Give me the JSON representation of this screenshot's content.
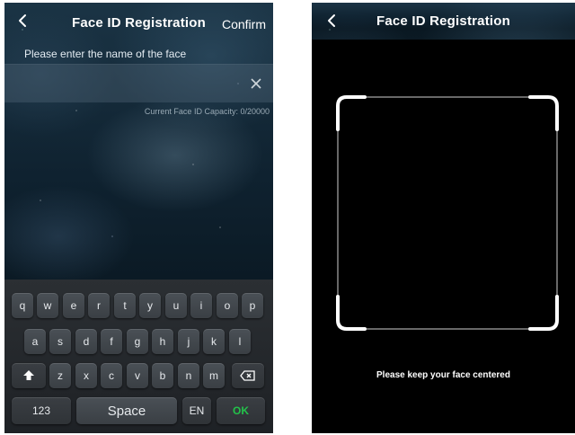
{
  "left_screen": {
    "header": {
      "title": "Face ID Registration",
      "confirm_label": "Confirm"
    },
    "prompt": "Please enter the name of the face",
    "name_input": {
      "value": "",
      "placeholder": ""
    },
    "capacity": "Current Face ID Capacity: 0/20000",
    "keyboard": {
      "row1": [
        "q",
        "w",
        "e",
        "r",
        "t",
        "y",
        "u",
        "i",
        "o",
        "p"
      ],
      "row2": [
        "a",
        "s",
        "d",
        "f",
        "g",
        "h",
        "j",
        "k",
        "l"
      ],
      "row3": [
        "z",
        "x",
        "c",
        "v",
        "b",
        "n",
        "m"
      ],
      "numbers_label": "123",
      "space_label": "Space",
      "language_label": "EN",
      "ok_label": "OK"
    }
  },
  "right_screen": {
    "header": {
      "title": "Face ID Registration"
    },
    "hint": "Please keep your face centered"
  },
  "colors": {
    "ok_accent": "#23c24a",
    "header_bg": "#1b3445"
  }
}
